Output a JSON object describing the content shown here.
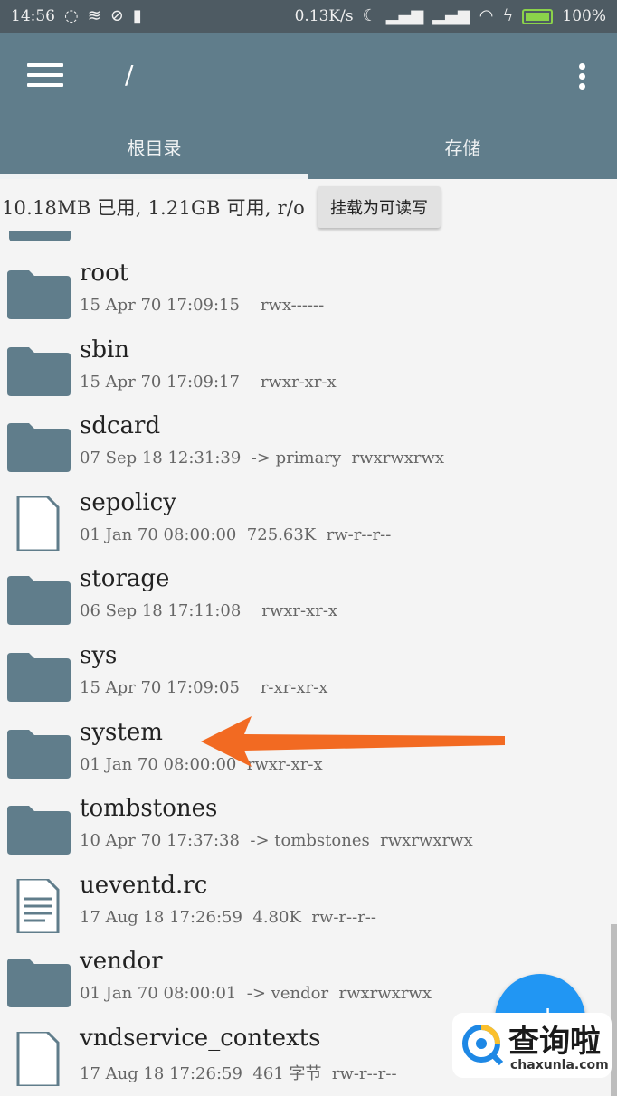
{
  "status_bar": {
    "time": "14:56",
    "net_speed": "0.13K/s",
    "battery_percent": "100%",
    "battery_level": 1.0
  },
  "app_bar": {
    "path": "/",
    "tabs": [
      {
        "label": "根目录",
        "active": true
      },
      {
        "label": "存储",
        "active": false
      }
    ]
  },
  "storage": {
    "info": "10.18MB 已用, 1.21GB 可用, r/o",
    "mount_button": "挂载为可读写"
  },
  "files": [
    {
      "name": "root",
      "type": "folder",
      "meta": "15 Apr 70 17:09:15    rwx------"
    },
    {
      "name": "sbin",
      "type": "folder",
      "meta": "15 Apr 70 17:09:17    rwxr-xr-x"
    },
    {
      "name": "sdcard",
      "type": "folder",
      "meta": "07 Sep 18 12:31:39  -> primary  rwxrwxrwx"
    },
    {
      "name": "sepolicy",
      "type": "file",
      "meta": "01 Jan 70 08:00:00  725.63K  rw-r--r--"
    },
    {
      "name": "storage",
      "type": "folder",
      "meta": "06 Sep 18 17:11:08    rwxr-xr-x"
    },
    {
      "name": "sys",
      "type": "folder",
      "meta": "15 Apr 70 17:09:05    r-xr-xr-x"
    },
    {
      "name": "system",
      "type": "folder",
      "meta": "01 Jan 70 08:00:00  rwxr-xr-x"
    },
    {
      "name": "tombstones",
      "type": "folder",
      "meta": "10 Apr 70 17:37:38  -> tombstones  rwxrwxrwx"
    },
    {
      "name": "ueventd.rc",
      "type": "textfile",
      "meta": "17 Aug 18 17:26:59  4.80K  rw-r--r--"
    },
    {
      "name": "vendor",
      "type": "folder",
      "meta": "01 Jan 70 08:00:01  -> vendor  rwxrwxrwx"
    },
    {
      "name": "vndservice_contexts",
      "type": "file",
      "meta": "17 Aug 18 17:26:59  461 字节  rw-r--r--"
    }
  ],
  "fab": {
    "label": "+"
  },
  "watermark": {
    "cn": "查询啦",
    "en": "chaxunla.com"
  },
  "colors": {
    "app_bar": "#607d8b",
    "status_bar": "#4e5b63",
    "folder": "#607d8b",
    "arrow": "#f26a22",
    "fab": "#2196f3"
  },
  "icons": {
    "menu": "hamburger-icon",
    "overflow": "more-vert-icon",
    "folder": "folder-icon",
    "file": "file-icon",
    "text_file": "text-file-icon"
  }
}
